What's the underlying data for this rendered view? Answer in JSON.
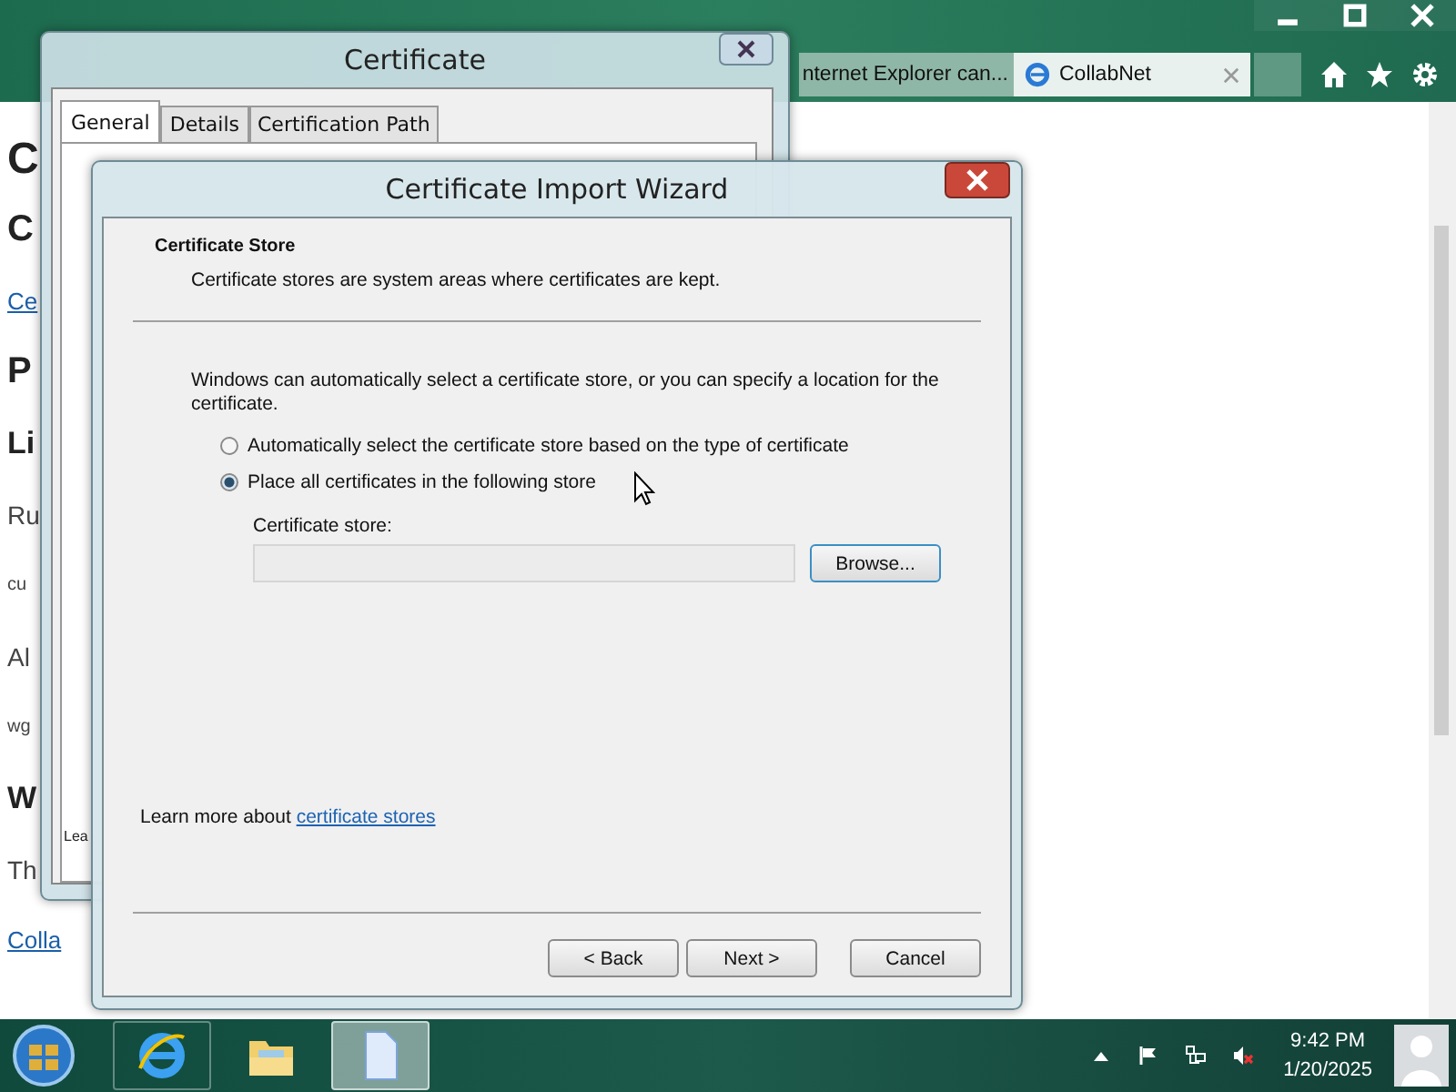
{
  "browser": {
    "tabs": [
      {
        "title": "nternet Explorer can...",
        "selected": false
      },
      {
        "title": "CollabNet",
        "selected": true
      }
    ]
  },
  "page": {
    "fragments": [
      {
        "text": "C",
        "kind": "h1"
      },
      {
        "text": "C",
        "kind": "h2"
      },
      {
        "text": "Ce",
        "kind": "link"
      },
      {
        "text": "P",
        "kind": "h2"
      },
      {
        "text": "Li",
        "kind": "h3"
      },
      {
        "text": "Ru",
        "kind": "text"
      },
      {
        "text": "cu",
        "kind": "small"
      },
      {
        "text": "Al",
        "kind": "text"
      },
      {
        "text": "wg",
        "kind": "small"
      },
      {
        "text": "W",
        "kind": "h3"
      },
      {
        "text": "Th",
        "kind": "text"
      },
      {
        "text": "Colla",
        "kind": "link"
      }
    ]
  },
  "certificate_dialog": {
    "title": "Certificate",
    "tabs": [
      {
        "label": "General",
        "selected": true
      },
      {
        "label": "Details",
        "selected": false
      },
      {
        "label": "Certification Path",
        "selected": false
      }
    ],
    "footer_fragment": "Lea"
  },
  "wizard": {
    "title": "Certificate Import Wizard",
    "header": {
      "title": "Certificate Store",
      "subtitle": "Certificate stores are system areas where certificates are kept."
    },
    "intro": "Windows can automatically select a certificate store, or you can specify a location for the certificate.",
    "options": [
      {
        "label": "Automatically select the certificate store based on the type of certificate",
        "selected": false
      },
      {
        "label": "Place all certificates in the following store",
        "selected": true
      }
    ],
    "store_label": "Certificate store:",
    "browse_button": "Browse...",
    "learn_more": {
      "text": "Learn more about",
      "link": "certificate stores"
    },
    "buttons": [
      "< Back",
      "Next >",
      "Cancel"
    ]
  },
  "taskbar": {
    "apps": [
      {
        "kind": "ie",
        "selected": false
      },
      {
        "kind": "folder",
        "selected": false
      },
      {
        "kind": "document",
        "selected": true
      }
    ],
    "time": "9:42 PM",
    "date": "1/20/2025"
  }
}
